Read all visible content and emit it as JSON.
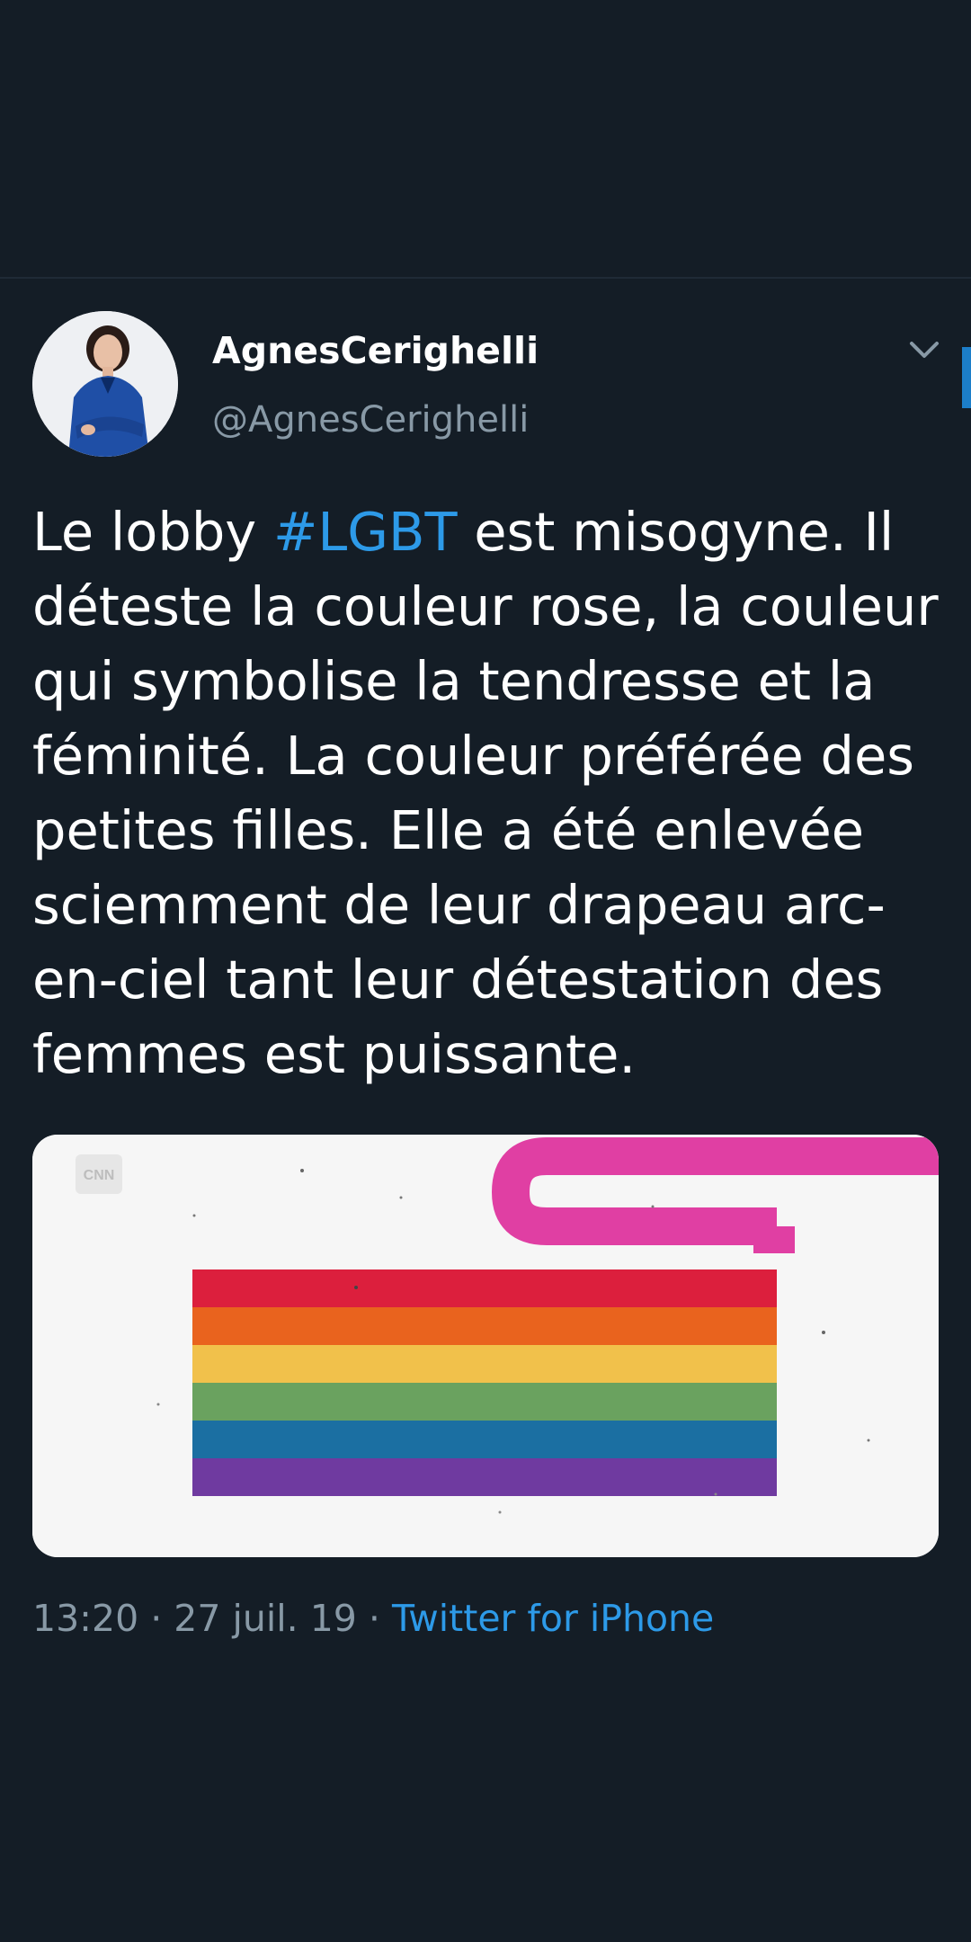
{
  "tweet": {
    "author": {
      "display_name": "AgnesCerighelli",
      "handle": "@AgnesCerighelli"
    },
    "text_parts": {
      "before": "Le lobby ",
      "hashtag": "#LGBT",
      "after": " est misogyne. Il déteste la couleur rose, la couleur qui symbolise la tendresse et la féminité. La couleur préférée des petites filles. Elle a été enlevée sciemment de leur drapeau arc-en-ciel tant leur détestation des femmes est puissante."
    },
    "media": {
      "watermark": "CNN",
      "flag_stripes": [
        "#dc1f3d",
        "#e9631e",
        "#f1c14b",
        "#6aa25f",
        "#1b6fa2",
        "#6f3aa0"
      ],
      "pink_stripe": "#e03fa3"
    },
    "meta": {
      "time": "13:20",
      "separator": " · ",
      "date": "27 juil. 19",
      "source": "Twitter for iPhone"
    }
  },
  "theme": {
    "background": "#141d26",
    "text": "#ffffff",
    "secondary_text": "#8899a6",
    "link": "#2d9ae8"
  }
}
